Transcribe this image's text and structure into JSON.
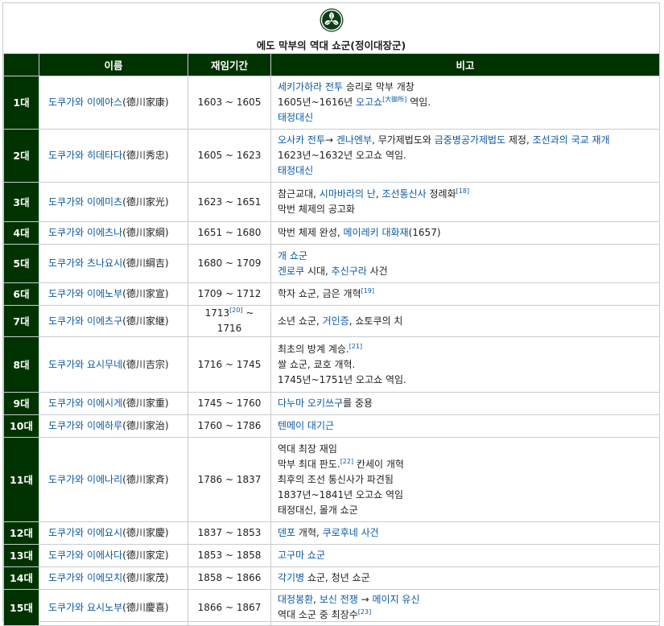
{
  "caption": "에도 막부의 역대 쇼군(정이대장군)",
  "crest_icon": "tokugawa-hollyhock-crest-icon",
  "colors": {
    "header_bg": "#003300",
    "link": "#0b5aa6",
    "border": "#c8ccd1"
  },
  "columns": [
    "",
    "이름",
    "재임기간",
    "비고"
  ],
  "rows": [
    {
      "gen": "1대",
      "name_link": "도쿠가와 이에야스",
      "name_kanji": "(德川家康)",
      "period_start": "1603",
      "period_sup": "",
      "period_end": "1605",
      "notes": [
        [
          {
            "t": "세키가하라 전투",
            "l": true
          },
          {
            "t": " 승리로 막부 개창",
            "l": false
          }
        ],
        [
          {
            "t": "1605년~1616년 ",
            "l": false
          },
          {
            "t": "오고쇼",
            "l": true
          },
          {
            "t": "[大御所]",
            "s": true
          },
          {
            "t": " 역임.",
            "l": false
          }
        ],
        [
          {
            "t": "태정대신",
            "l": true
          }
        ]
      ],
      "h": 66
    },
    {
      "gen": "2대",
      "name_link": "도쿠가와 히데타다",
      "name_kanji": "(德川秀忠)",
      "period_start": "1605",
      "period_sup": "",
      "period_end": "1623",
      "notes": [
        [
          {
            "t": "오사카 전투",
            "l": true
          },
          {
            "t": "→ ",
            "l": false
          },
          {
            "t": "겐나엔부",
            "l": true
          },
          {
            "t": ", 무가제법도와 ",
            "l": false
          },
          {
            "t": "금중병공가제법도",
            "l": true
          },
          {
            "t": " 제정, ",
            "l": false
          },
          {
            "t": "조선과의 국교 재개",
            "l": true
          }
        ],
        [
          {
            "t": "1623년~1632년 오고쇼 역임.",
            "l": false
          }
        ],
        [
          {
            "t": "태정대신",
            "l": true
          }
        ]
      ],
      "h": 66
    },
    {
      "gen": "3대",
      "name_link": "도쿠가와 이에미츠",
      "name_kanji": "(德川家光)",
      "period_start": "1623",
      "period_sup": "",
      "period_end": "1651",
      "notes": [
        [
          {
            "t": "참근교대, ",
            "l": false
          },
          {
            "t": "시마바라의 난",
            "l": true
          },
          {
            "t": ", ",
            "l": false
          },
          {
            "t": "조선통신사",
            "l": true
          },
          {
            "t": " 정례화",
            "l": false
          },
          {
            "t": "[18]",
            "s": true
          }
        ],
        [
          {
            "t": "막번 체제의 공고화",
            "l": false
          }
        ]
      ],
      "h": 49
    },
    {
      "gen": "4대",
      "name_link": "도쿠가와 이에츠나",
      "name_kanji": "(德川家綱)",
      "period_start": "1651",
      "period_sup": "",
      "period_end": "1680",
      "notes": [
        [
          {
            "t": "막번 체제 완성, ",
            "l": false
          },
          {
            "t": "메이레키 대화재",
            "l": true
          },
          {
            "t": "(1657)",
            "l": false
          }
        ]
      ],
      "h": 28
    },
    {
      "gen": "5대",
      "name_link": "도쿠가와 츠나요시",
      "name_kanji": "(德川綱吉)",
      "period_start": "1680",
      "period_sup": "",
      "period_end": "1709",
      "notes": [
        [
          {
            "t": "개 쇼군",
            "l": true
          }
        ],
        [
          {
            "t": "겐로쿠",
            "l": true
          },
          {
            "t": " 시대, ",
            "l": false
          },
          {
            "t": "추신구라",
            "l": true
          },
          {
            "t": " 사건",
            "l": false
          }
        ]
      ],
      "h": 48
    },
    {
      "gen": "6대",
      "name_link": "도쿠가와 이에노부",
      "name_kanji": "(德川家宣)",
      "period_start": "1709",
      "period_sup": "",
      "period_end": "1712",
      "notes": [
        [
          {
            "t": "학자 쇼군, 금은 개혁",
            "l": false
          },
          {
            "t": "[19]",
            "s": true
          }
        ]
      ],
      "h": 28
    },
    {
      "gen": "7대",
      "name_link": "도쿠가와 이에츠구",
      "name_kanji": "(德川家継)",
      "period_start": "1713",
      "period_sup": "[20]",
      "period_end": "1716",
      "notes": [
        [
          {
            "t": "소년 쇼군, ",
            "l": false
          },
          {
            "t": "거인증",
            "l": true
          },
          {
            "t": ", 쇼토쿠의 치",
            "l": false
          }
        ]
      ],
      "h": 29
    },
    {
      "gen": "8대",
      "name_link": "도쿠가와 요시무네",
      "name_kanji": "(德川吉宗)",
      "period_start": "1716",
      "period_sup": "",
      "period_end": "1745",
      "notes": [
        [
          {
            "t": "최초의 방계 계승.",
            "l": false
          },
          {
            "t": "[21]",
            "s": true
          }
        ],
        [
          {
            "t": "쌀 쇼군, 쿄호 개혁.",
            "l": false
          }
        ],
        [
          {
            "t": "1745년~1751년 오고쇼 역임.",
            "l": false
          }
        ]
      ],
      "h": 69
    },
    {
      "gen": "9대",
      "name_link": "도쿠가와 이에시게",
      "name_kanji": "(德川家重)",
      "period_start": "1745",
      "period_sup": "",
      "period_end": "1760",
      "notes": [
        [
          {
            "t": "다누마 오키쓰구",
            "l": true
          },
          {
            "t": "를 중용",
            "l": false
          }
        ]
      ],
      "h": 28
    },
    {
      "gen": "10대",
      "name_link": "도쿠가와 이에하루",
      "name_kanji": "(德川家治)",
      "period_start": "1760",
      "period_sup": "",
      "period_end": "1786",
      "notes": [
        [
          {
            "t": "텐메이 대기근",
            "l": true
          }
        ]
      ],
      "h": 28
    },
    {
      "gen": "11대",
      "name_link": "도쿠가와 이에나리",
      "name_kanji": "(德川家斉)",
      "period_start": "1786",
      "period_sup": "",
      "period_end": "1837",
      "notes": [
        [
          {
            "t": "역대 최장 재임",
            "l": false
          }
        ],
        [
          {
            "t": "막부 최대 판도.",
            "l": false
          },
          {
            "t": "[22]",
            "s": true
          },
          {
            "t": " 칸세이 개혁",
            "l": false
          }
        ],
        [
          {
            "t": "최후의 조선 통신사가 파견됨",
            "l": false
          }
        ],
        [
          {
            "t": "1837년~1841년 오고쇼 역임",
            "l": false
          }
        ],
        [
          {
            "t": "태정대신, 몰개 쇼군",
            "l": false
          }
        ]
      ],
      "h": 105
    },
    {
      "gen": "12대",
      "name_link": "도쿠가와 이에요시",
      "name_kanji": "(德川家慶)",
      "period_start": "1837",
      "period_sup": "",
      "period_end": "1853",
      "notes": [
        [
          {
            "t": "덴포",
            "l": true
          },
          {
            "t": " 개혁, ",
            "l": false
          },
          {
            "t": "쿠로후네 사건",
            "l": true
          }
        ]
      ],
      "h": 28
    },
    {
      "gen": "13대",
      "name_link": "도쿠가와 이에사다",
      "name_kanji": "(德川家定)",
      "period_start": "1853",
      "period_sup": "",
      "period_end": "1858",
      "notes": [
        [
          {
            "t": "고구마 쇼군",
            "l": true
          }
        ]
      ],
      "h": 28
    },
    {
      "gen": "14대",
      "name_link": "도쿠가와 이에모치",
      "name_kanji": "(德川家茂)",
      "period_start": "1858",
      "period_sup": "",
      "period_end": "1866",
      "notes": [
        [
          {
            "t": "각기병",
            "l": true
          },
          {
            "t": " 쇼군, 청년 쇼군",
            "l": false
          }
        ]
      ],
      "h": 28
    },
    {
      "gen": "15대",
      "name_link": "도쿠가와 요시노부",
      "name_kanji": "(德川慶喜)",
      "period_start": "1866",
      "period_sup": "",
      "period_end": "1867",
      "notes": [
        [
          {
            "t": "대정봉환",
            "l": true
          },
          {
            "t": ", ",
            "l": false
          },
          {
            "t": "보신 전쟁",
            "l": true
          },
          {
            "t": " → ",
            "l": false
          },
          {
            "t": "메이지 유신",
            "l": true
          }
        ],
        [
          {
            "t": "역대 소군 중 최장수",
            "l": false
          },
          {
            "t": "[23]",
            "s": true
          }
        ]
      ],
      "h": 44
    }
  ]
}
